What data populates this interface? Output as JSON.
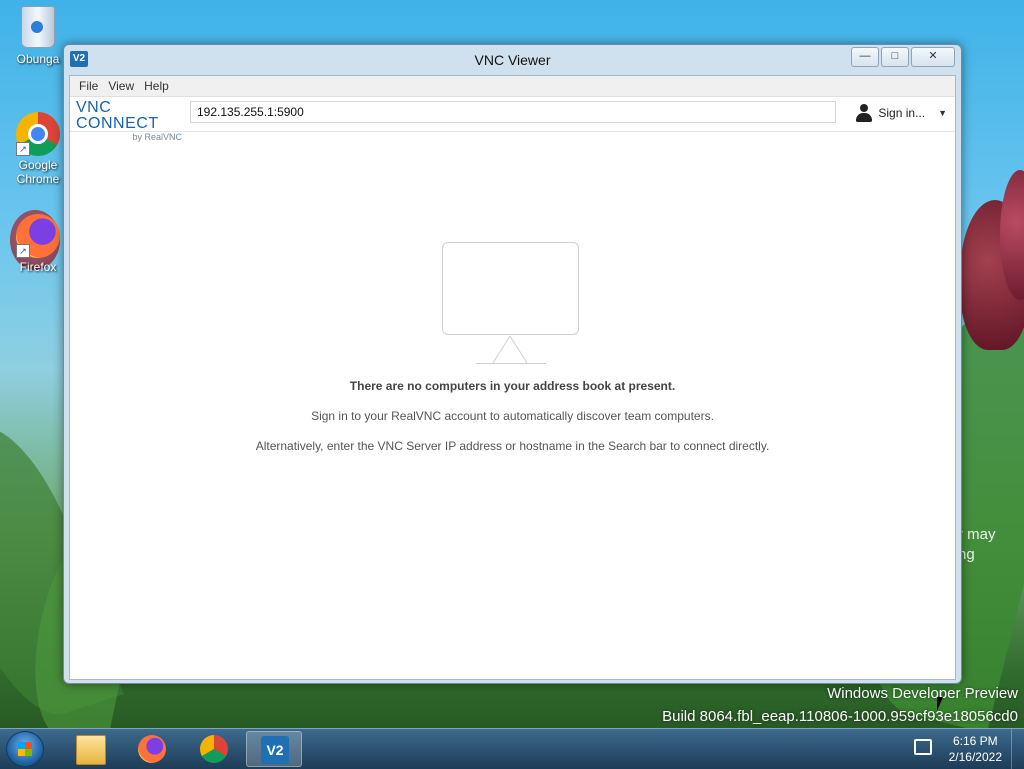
{
  "desktop": {
    "icons": [
      {
        "label": "Obunga",
        "icon": "recycle-bin-icon"
      },
      {
        "label": "Google\nChrome",
        "label_line1": "Google",
        "label_line2": "Chrome",
        "icon": "chrome-icon"
      },
      {
        "label": "Firefox",
        "icon": "firefox-icon"
      }
    ],
    "watermark_line1": "Windows Developer Preview",
    "watermark_line2": "Build 8064.fbl_eeap.110806-1000.959cf93e18056cd0",
    "background_text_line1": "r may",
    "background_text_line2": "ng"
  },
  "window": {
    "title": "VNC Viewer",
    "app_icon_text": "V2",
    "controls": {
      "minimize": "—",
      "maximize": "□",
      "close": "✕"
    },
    "menu": [
      "File",
      "View",
      "Help"
    ],
    "brand": {
      "main": "VNC CONNECT",
      "sub": "by RealVNC"
    },
    "address_value": "192.135.255.1:5900",
    "signin_label": "Sign in...",
    "empty_state": {
      "heading": "There are no computers in your address book at present.",
      "line1": "Sign in to your RealVNC account to automatically discover team computers.",
      "line2": "Alternatively, enter the VNC Server IP address or hostname in the Search bar to connect directly."
    }
  },
  "taskbar": {
    "pinned": [
      {
        "name": "file-explorer-icon"
      },
      {
        "name": "firefox-icon"
      },
      {
        "name": "chrome-icon"
      },
      {
        "name": "vnc-viewer-icon",
        "text": "V2",
        "active": true
      }
    ],
    "time": "6:16 PM",
    "date": "2/16/2022"
  },
  "colors": {
    "brand_blue": "#1a62b0",
    "taskbar_top": "#3d6a8e",
    "taskbar_bottom": "#1d3c57",
    "window_frame": "#cfe0ef"
  }
}
